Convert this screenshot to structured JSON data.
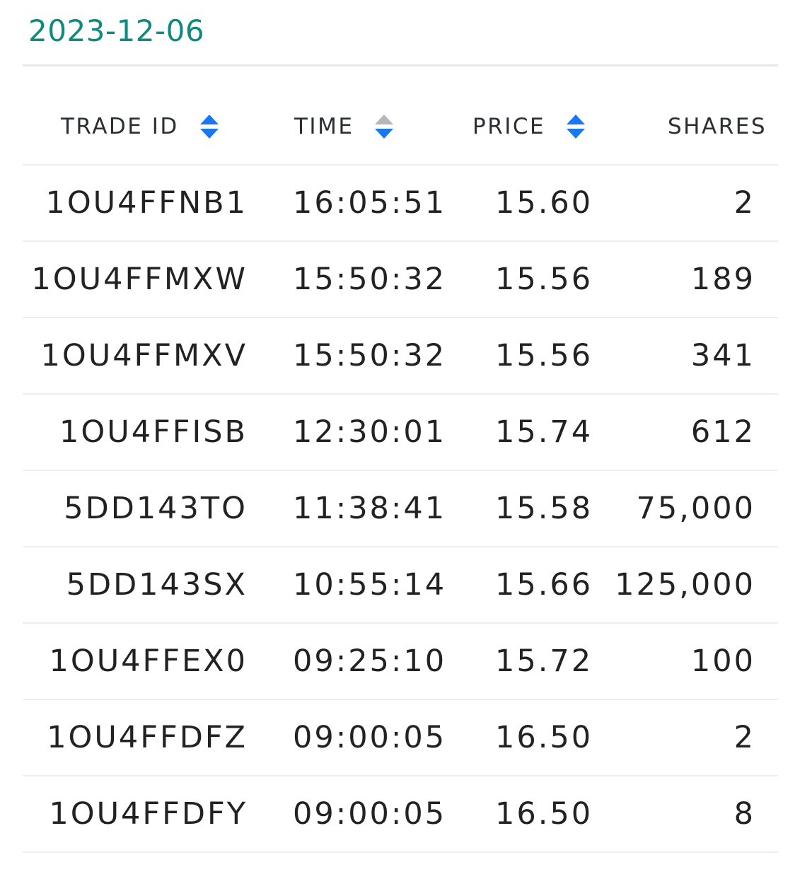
{
  "date": "2023-12-06",
  "columns": [
    {
      "label": "TRADE ID",
      "sortable": true
    },
    {
      "label": "TIME",
      "sortable": true
    },
    {
      "label": "PRICE",
      "sortable": true
    },
    {
      "label": "SHARES",
      "sortable": false
    }
  ],
  "sort_icons": {
    "active_color": "#1877f2",
    "inactive_color": "#b3b6ba"
  },
  "rows": [
    {
      "trade_id": "1OU4FFNB1",
      "time": "16:05:51",
      "price": "15.60",
      "shares": "2"
    },
    {
      "trade_id": "1OU4FFMXW",
      "time": "15:50:32",
      "price": "15.56",
      "shares": "189"
    },
    {
      "trade_id": "1OU4FFMXV",
      "time": "15:50:32",
      "price": "15.56",
      "shares": "341"
    },
    {
      "trade_id": "1OU4FFISB",
      "time": "12:30:01",
      "price": "15.74",
      "shares": "612"
    },
    {
      "trade_id": "5DD143TO",
      "time": "11:38:41",
      "price": "15.58",
      "shares": "75,000"
    },
    {
      "trade_id": "5DD143SX",
      "time": "10:55:14",
      "price": "15.66",
      "shares": "125,000"
    },
    {
      "trade_id": "1OU4FFEX0",
      "time": "09:25:10",
      "price": "15.72",
      "shares": "100"
    },
    {
      "trade_id": "1OU4FFDFZ",
      "time": "09:00:05",
      "price": "16.50",
      "shares": "2"
    },
    {
      "trade_id": "1OU4FFDFY",
      "time": "09:00:05",
      "price": "16.50",
      "shares": "8"
    }
  ],
  "colors": {
    "date": "#0e8a7e",
    "text": "#222222",
    "divider": "#eceeef"
  }
}
